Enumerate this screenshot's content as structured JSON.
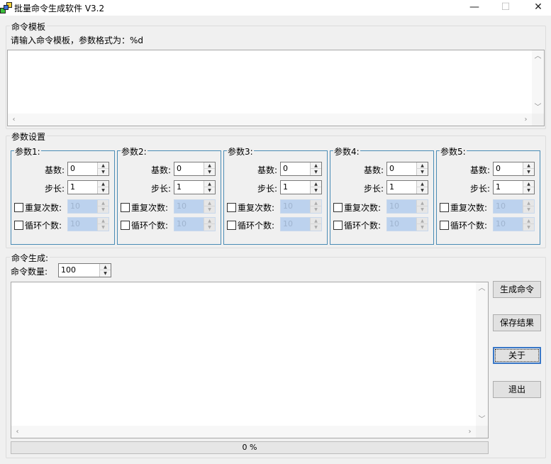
{
  "window": {
    "title": "批量命令生成软件 V3.2",
    "minimize_glyph": "—",
    "maximize_glyph": "☐",
    "close_glyph": "✕"
  },
  "template_section": {
    "label": "命令模板",
    "hint": "请输入命令模板，参数格式为：%d",
    "value": ""
  },
  "params_section": {
    "label": "参数设置",
    "groups": [
      {
        "label": "参数1:",
        "base_label": "基数:",
        "base_value": "0",
        "step_label": "步长:",
        "step_value": "1",
        "repeat_label": "重复次数:",
        "repeat_value": "10",
        "repeat_checked": false,
        "cycle_label": "循环个数:",
        "cycle_value": "10",
        "cycle_checked": false
      },
      {
        "label": "参数2:",
        "base_label": "基数:",
        "base_value": "0",
        "step_label": "步长:",
        "step_value": "1",
        "repeat_label": "重复次数:",
        "repeat_value": "10",
        "repeat_checked": false,
        "cycle_label": "循环个数:",
        "cycle_value": "10",
        "cycle_checked": false
      },
      {
        "label": "参数3:",
        "base_label": "基数:",
        "base_value": "0",
        "step_label": "步长:",
        "step_value": "1",
        "repeat_label": "重复次数:",
        "repeat_value": "10",
        "repeat_checked": false,
        "cycle_label": "循环个数:",
        "cycle_value": "10",
        "cycle_checked": false
      },
      {
        "label": "参数4:",
        "base_label": "基数:",
        "base_value": "0",
        "step_label": "步长:",
        "step_value": "1",
        "repeat_label": "重复次数:",
        "repeat_value": "10",
        "repeat_checked": false,
        "cycle_label": "循环个数:",
        "cycle_value": "10",
        "cycle_checked": false
      },
      {
        "label": "参数5:",
        "base_label": "基数:",
        "base_value": "0",
        "step_label": "步长:",
        "step_value": "1",
        "repeat_label": "重复次数:",
        "repeat_value": "10",
        "repeat_checked": false,
        "cycle_label": "循环个数:",
        "cycle_value": "10",
        "cycle_checked": false
      }
    ]
  },
  "generate_section": {
    "label": "命令生成:",
    "count_label": "命令数量:",
    "count_value": "100",
    "output_value": "",
    "progress_text": "0 %",
    "progress": 0
  },
  "buttons": {
    "generate": "生成命令",
    "save": "保存结果",
    "about": "关于",
    "exit": "退出"
  },
  "colors": {
    "param_group_border": "#4a8bb5",
    "disabled_field": "#bcd2ee",
    "focus_border": "#3a78c8"
  }
}
